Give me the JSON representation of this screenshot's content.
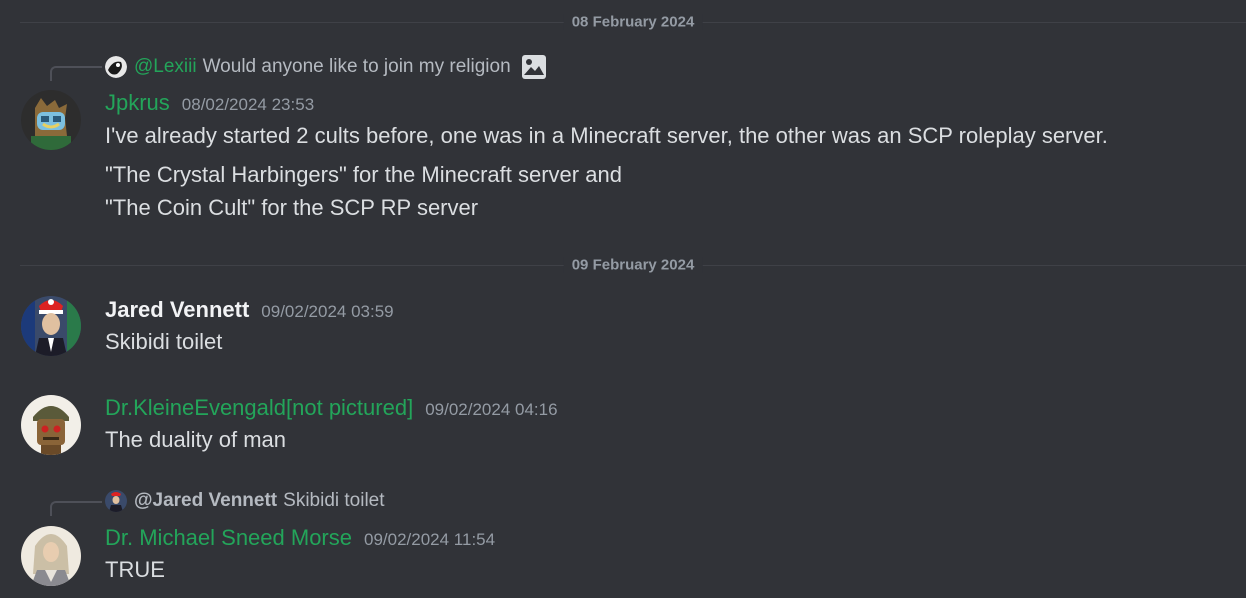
{
  "dividers": [
    "08 February 2024",
    "09 February 2024"
  ],
  "messages": [
    {
      "reply": {
        "mention": "@Lexiii",
        "text": "Would anyone like to join my religion"
      },
      "author": "Jpkrus",
      "timestamp": "08/02/2024 23:53",
      "lines": [
        "I've already started 2 cults before, one was in a Minecraft server, the other was an SCP roleplay server.",
        "\"The Crystal Harbingers\" for the Minecraft server and",
        "\"The Coin Cult\" for the SCP RP server"
      ]
    },
    {
      "author": "Jared Vennett",
      "timestamp": "09/02/2024 03:59",
      "lines": [
        "Skibidi toilet"
      ]
    },
    {
      "author": "Dr.KleineEvengald[not pictured]",
      "timestamp": "09/02/2024 04:16",
      "lines": [
        "The duality of man"
      ]
    },
    {
      "reply": {
        "mention": "@Jared Vennett",
        "text": "Skibidi toilet"
      },
      "author": "Dr. Michael Sneed Morse",
      "timestamp": "09/02/2024 11:54",
      "lines": [
        "TRUE"
      ]
    }
  ],
  "colors": {
    "background": "#313338",
    "green_role": "#23a55a",
    "muted": "#949ba4"
  }
}
